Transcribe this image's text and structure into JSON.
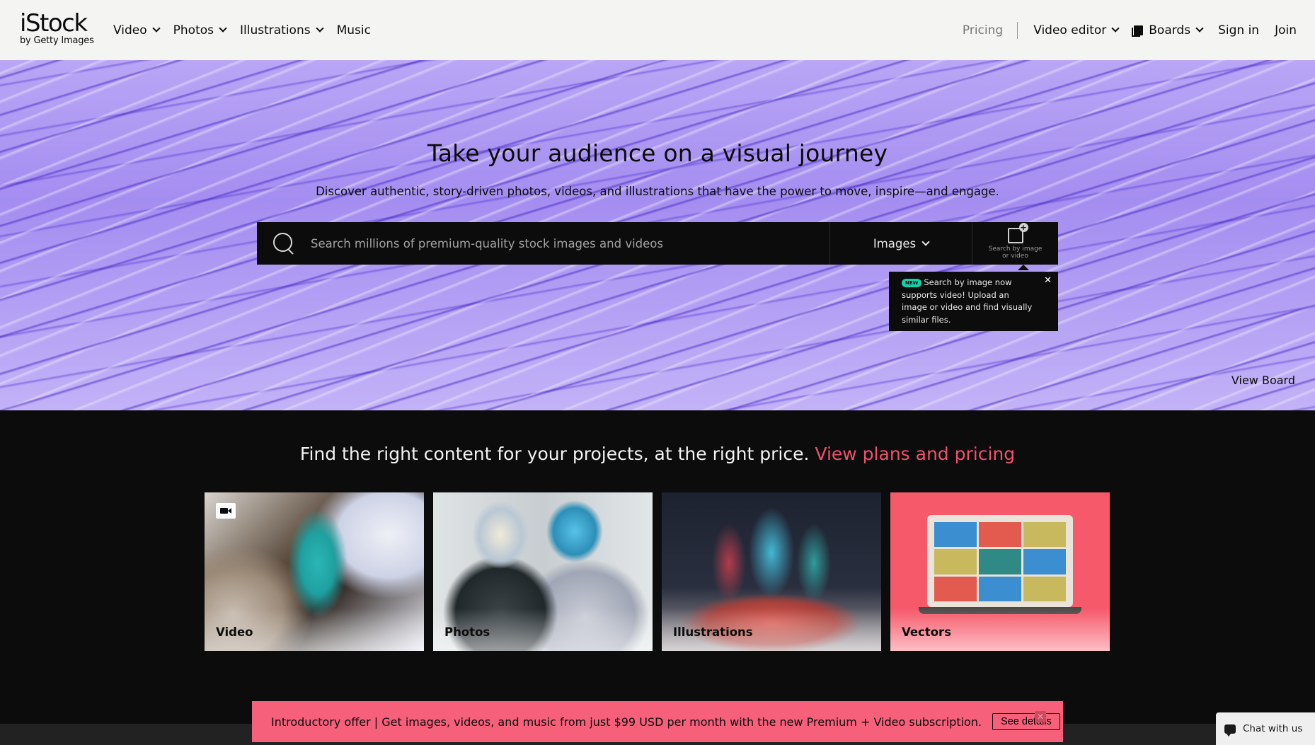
{
  "header": {
    "logo_main": "iStock",
    "logo_sub": "by Getty Images",
    "nav_left": [
      {
        "label": "Video"
      },
      {
        "label": "Photos"
      },
      {
        "label": "Illustrations"
      },
      {
        "label": "Music"
      }
    ],
    "pricing": "Pricing",
    "video_editor": "Video editor",
    "boards": "Boards",
    "sign_in": "Sign in",
    "join": "Join"
  },
  "hero": {
    "title": "Take your audience on a visual journey",
    "subtitle": "Discover authentic, story-driven photos, videos, and illustrations that have the power to move, inspire—and engage.",
    "search_placeholder": "Search millions of premium-quality stock images and videos",
    "search_value": "",
    "search_type": "Images",
    "search_by_image": "Search by image or video",
    "tooltip_badge": "NEW",
    "tooltip_text": "Search by image now supports video! Upload an image or video and find visually similar files.",
    "tooltip_close": "✕",
    "view_board": "View Board"
  },
  "content": {
    "promo_text": "Find the right content for your projects, at the right price.",
    "promo_link": "View plans and pricing",
    "cards": [
      {
        "label": "Video"
      },
      {
        "label": "Photos"
      },
      {
        "label": "Illustrations"
      },
      {
        "label": "Vectors"
      }
    ]
  },
  "offer": {
    "text": "Introductory offer | Get images, videos, and music from just $99 USD per month with the new Premium + Video subscription.",
    "button": "See details",
    "close": "✕"
  },
  "chat": {
    "label": "Chat with us"
  },
  "colors": {
    "accent_pink": "#f0506e",
    "offer_bg": "#f6607a",
    "dark_bg": "#0c0c0c",
    "header_bg": "#f4f4f3",
    "new_badge": "#0ed3a8"
  },
  "icons": [
    "search-icon",
    "chevron-down-icon",
    "boards-icon",
    "image-search-icon",
    "close-icon",
    "video-camera-icon",
    "chat-icon"
  ]
}
